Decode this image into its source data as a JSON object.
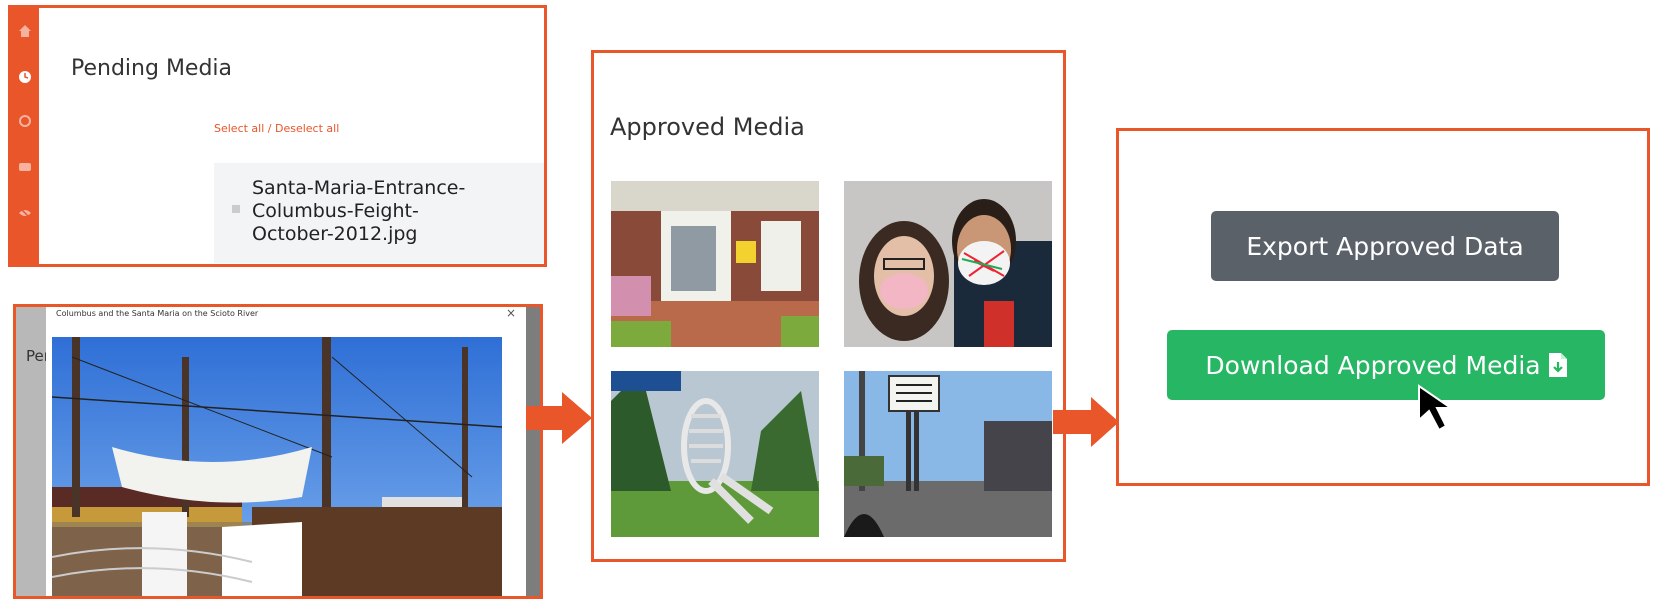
{
  "pending": {
    "title": "Pending Media",
    "select_all": "Select all",
    "separator": " / ",
    "deselect_all": "Deselect all",
    "file_name": "Santa-Maria-Entrance-Columbus-Feight-October-2012.jpg",
    "sidebar_icons": [
      "home-icon",
      "clock-icon",
      "gear-icon",
      "chat-icon",
      "hide-icon"
    ]
  },
  "modal": {
    "behind_text": "Per",
    "header": "Columbus and the Santa Maria on the Scioto River",
    "close": "×"
  },
  "approved": {
    "title": "Approved Media",
    "thumbnails": [
      "porch-photo",
      "couple-masks-photo",
      "skeleton-photo",
      "street-sign-photo"
    ]
  },
  "export": {
    "export_label": "Export Approved Data",
    "download_label": "Download Approved Media"
  },
  "colors": {
    "accent": "#e8562a",
    "export_button": "#5a6169",
    "download_button": "#27b663"
  }
}
